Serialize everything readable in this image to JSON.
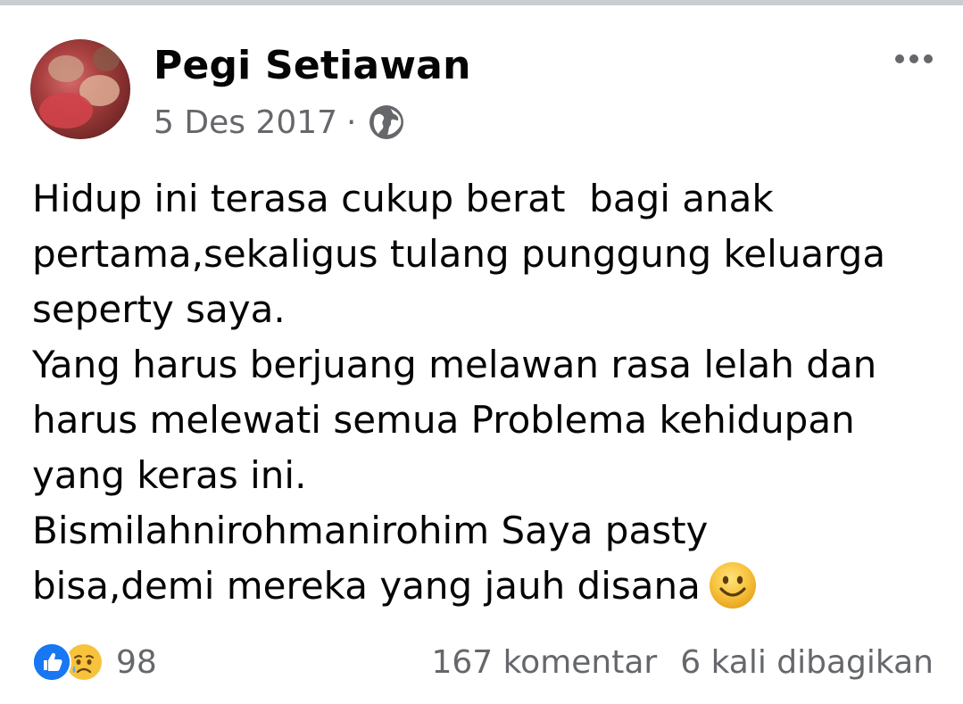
{
  "post": {
    "author": "Pegi Setiawan",
    "date": "5 Des 2017",
    "separator": "·",
    "privacy_icon": "globe-icon",
    "more_icon": "more-options-icon",
    "body_lines": [
      "Hidup ini terasa cukup berat  bagi anak",
      "pertama,sekaligus tulang punggung keluarga",
      "seperty saya.",
      "Yang harus berjuang melawan rasa lelah dan",
      "harus melewati semua Problema kehidupan",
      "yang keras ini.",
      "Bismilahnirohmanirohim Saya pasty",
      "bisa,demi mereka yang jauh disana"
    ],
    "body_emoji": "smiling-face-icon"
  },
  "footer": {
    "reactions": [
      "like-icon",
      "sad-icon"
    ],
    "reaction_count": "98",
    "comments": "167 komentar",
    "shares": "6 kali dibagikan"
  },
  "colors": {
    "text": "#050505",
    "secondary_text": "#65676b",
    "like_blue": "#1877f2",
    "emoji_yellow": "#f7c33d",
    "divider": "#c9ccd1"
  }
}
